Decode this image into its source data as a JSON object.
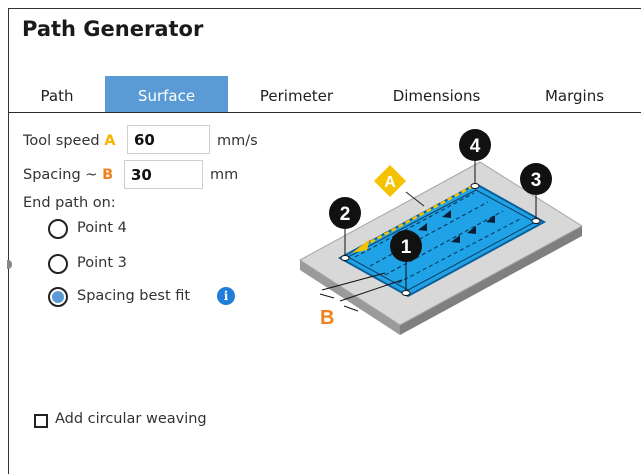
{
  "title": "Path Generator",
  "tabs": [
    {
      "label": "Path",
      "active": false
    },
    {
      "label": "Surface",
      "active": true
    },
    {
      "label": "Perimeter",
      "active": false
    },
    {
      "label": "Dimensions",
      "active": false
    },
    {
      "label": "Margins",
      "active": false
    }
  ],
  "tool_speed": {
    "label": "Tool speed",
    "marker": "A",
    "value": "60",
    "unit": "mm/s"
  },
  "spacing": {
    "label": "Spacing ~",
    "marker": "B",
    "value": "30",
    "unit": "mm"
  },
  "end_path": {
    "label": "End path on:",
    "options": [
      {
        "label": "Point 4",
        "selected": false
      },
      {
        "label": "Point 3",
        "selected": false
      },
      {
        "label": "Spacing best fit",
        "selected": true
      }
    ],
    "info_icon": "i"
  },
  "circular_weaving": {
    "label": "Add circular weaving",
    "checked": false
  },
  "diagram": {
    "points": [
      "1",
      "2",
      "3",
      "4"
    ],
    "marker_a": "A",
    "marker_b": "B"
  },
  "colors": {
    "accent": "#5a9bd5",
    "marker_orange": "#f0821e",
    "marker_yellow": "#f4c200",
    "surface_blue": "#1fa3e6",
    "info_blue": "#1f7ed8"
  }
}
